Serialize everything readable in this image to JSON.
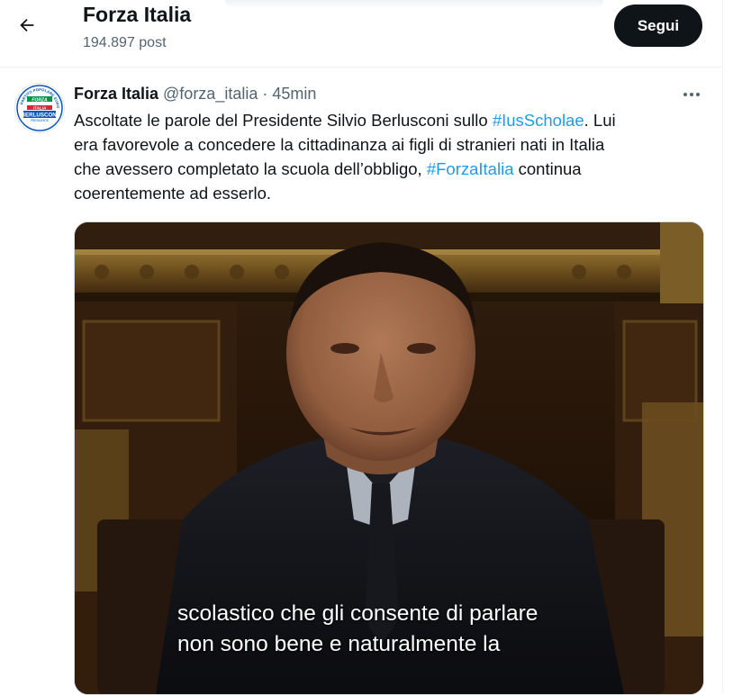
{
  "header": {
    "title": "Forza Italia",
    "post_count": "194.897 post",
    "follow_label": "Segui"
  },
  "tweet": {
    "author_name": "Forza Italia",
    "handle": "@forza_italia",
    "separator": "·",
    "time": "45min",
    "text": {
      "l1_a": "Ascoltate le parole del Presidente Silvio Berlusconi sullo ",
      "l1_tag": "#IusScholae",
      "l1_b": ". Lui",
      "l2": "era favorevole a concedere la cittadinanza ai figli di stranieri nati in Italia",
      "l3_a": "che avessero completato la scuola dell’obbligo, ",
      "l3_tag": "#ForzaItalia",
      "l3_b": " continua",
      "l4": "coerentemente ad esserlo."
    },
    "media": {
      "subtitle_line1": "scolastico che gli consente di parlare",
      "subtitle_line2": "non sono bene e naturalmente la"
    }
  },
  "avatar_logo": {
    "ring_text": "PARTITO POPOLARE EUROPEO",
    "word1": "FORZA",
    "word2": "ITALIA",
    "word3": "BERLUSCONI",
    "word4": "PRESIDENTE"
  },
  "colors": {
    "accent": "#1d9bf0",
    "follow_bg": "#0f1419",
    "muted": "#536471",
    "logo_blue": "#0a58b6"
  },
  "icons": {
    "back": "arrow-left-icon",
    "more": "more-dots-icon"
  }
}
